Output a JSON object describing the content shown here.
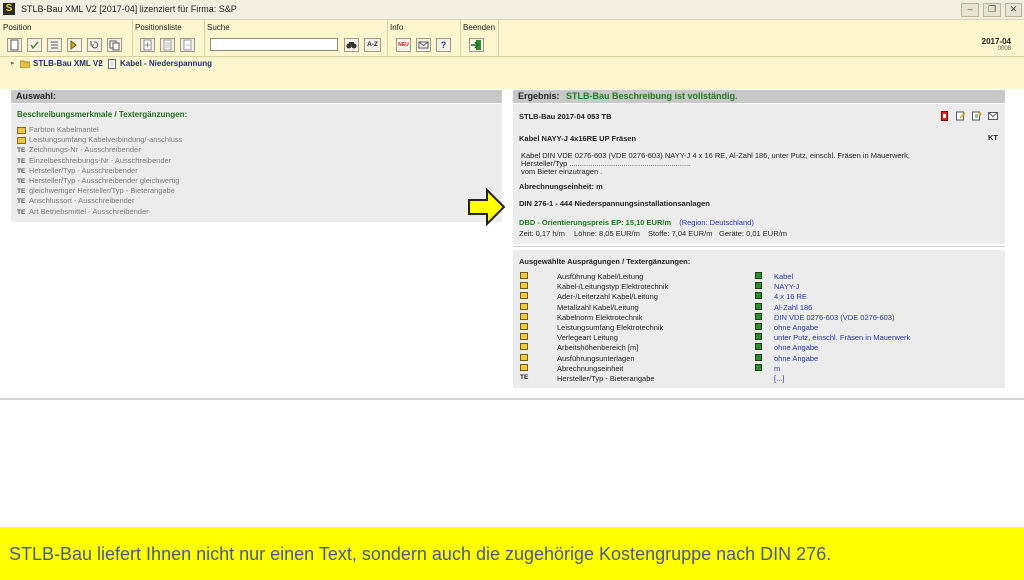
{
  "window": {
    "title": "STLB-Bau XML V2 [2017-04] lizenziert für Firma: S&P",
    "app_icon": "S"
  },
  "ribbon": {
    "groups": [
      "Position",
      "Positionsliste",
      "Suche",
      "Info",
      "Beenden"
    ],
    "search_value": "",
    "az_label": "A-Z",
    "neu_label": "NEU",
    "date": "2017-04",
    "date_sub": "0008"
  },
  "breadcrumb": {
    "root": "STLB-Bau XML V2",
    "current": "Kabel - Niederspannung"
  },
  "left": {
    "header": "Auswahl:",
    "section_title": "Beschreibungsmerkmale / Textergänzungen:",
    "items": [
      {
        "prefix": "",
        "label": "Farbton Kabelmantel"
      },
      {
        "prefix": "",
        "label": "Leistungsumfang Kabelverbindung/-anschluss"
      },
      {
        "prefix": "TE",
        "label": "Zeichnungs-Nr - Ausschreibender"
      },
      {
        "prefix": "TE",
        "label": "Einzelbeschreibungs-Nr - Ausschreibender"
      },
      {
        "prefix": "TE",
        "label": "Hersteller/Typ - Ausschreibender"
      },
      {
        "prefix": "TE",
        "label": "Hersteller/Typ - Ausschreibender gleichwertig"
      },
      {
        "prefix": "TE",
        "label": "gleichwertiger Hersteller/Typ - Bieterangabe"
      },
      {
        "prefix": "TE",
        "label": "Anschlussort - Ausschreibender"
      },
      {
        "prefix": "TE",
        "label": "Art Betriebsmittel - Ausschreibender"
      }
    ]
  },
  "right": {
    "header_label": "Ergebnis:",
    "header_status": "STLB-Bau Beschreibung ist vollständig.",
    "code": "STLB-Bau 2017-04 053 TB",
    "short_text": "Kabel NAYY-J 4x16RE UP Fräsen",
    "kt": "KT",
    "long_text_1": "Kabel DIN VDE 0276-603 (VDE 0276-603) NAYY-J 4 x 16 RE, Al-Zahl 186, unter Putz, einschl. Fräsen in Mauerwerk,",
    "long_text_2": "Hersteller/Typ ..........................................................",
    "long_text_3": "vom Bieter einzutragen .",
    "unit_label": "Abrechnungseinheit: m",
    "din": "DIN 276-1 - 444 Niederspannungsinstallationsanlagen",
    "price_label": "DBD - Orientierungspreis EP: 15,10 EUR/m",
    "region": "(Region: Deutschland)",
    "breakdown": {
      "zeit": "Zeit: 0,17 h/m",
      "loehne": "Löhne: 8,05 EUR/m",
      "stoffe": "Stoffe: 7,04 EUR/m",
      "geraete": "Geräte: 0,01 EUR/m"
    },
    "selected_title": "Ausgewählte Ausprägungen / Textergänzungen:",
    "selected": [
      {
        "prefix": "",
        "label": "Ausführung Kabel/Leitung",
        "value": "Kabel"
      },
      {
        "prefix": "",
        "label": "Kabel-/Leitungstyp Elektrotechnik",
        "value": "NAYY-J"
      },
      {
        "prefix": "",
        "label": "Ader-/Leiterzahl Kabel/Leitung",
        "value": "4 x 16 RE"
      },
      {
        "prefix": "",
        "label": "Metallzahl Kabel/Leitung",
        "value": "Al-Zahl 186"
      },
      {
        "prefix": "",
        "label": "Kabelnorm Elektrotechnik",
        "value": "DIN VDE 0276-603 (VDE 0276-603)"
      },
      {
        "prefix": "",
        "label": "Leistungsumfang Elektrotechnik",
        "value": "ohne Angabe"
      },
      {
        "prefix": "",
        "label": "Verlegeart Leitung",
        "value": "unter Putz, einschl. Fräsen in Mauerwerk"
      },
      {
        "prefix": "",
        "label": "Arbeitshöhenbereich [m]",
        "value": "ohne Angabe"
      },
      {
        "prefix": "",
        "label": "Ausführungsunterlagen",
        "value": "ohne Angabe"
      },
      {
        "prefix": "",
        "label": "Abrechnungseinheit",
        "value": "m"
      },
      {
        "prefix": "TE",
        "label": "Hersteller/Typ - Bieterangabe",
        "value": "[...]"
      }
    ]
  },
  "caption": "STLB-Bau liefert Ihnen nicht nur einen Text, sondern auch die zugehörige Kostengruppe nach DIN 276.",
  "colors": {
    "ribbon_bg": "#fbf6cd",
    "caption_bg": "#ffff00",
    "status_green": "#1e7a1e",
    "link_blue": "#2233aa",
    "arrow_yellow": "#ffff00"
  }
}
